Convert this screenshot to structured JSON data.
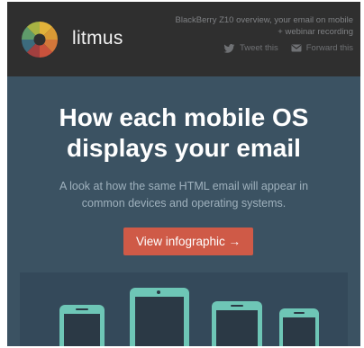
{
  "header": {
    "brand": "litmus",
    "promo_text": "BlackBerry Z10 overview, your email on mobile + webinar recording",
    "actions": [
      {
        "label": "Tweet this",
        "icon": "twitter-bird-icon"
      },
      {
        "label": "Forward this",
        "icon": "envelope-icon"
      }
    ]
  },
  "hero": {
    "title_line1": "How each mobile OS",
    "title_line2": "displays your email",
    "subtitle_line1": "A look at how the same HTML email will appear in",
    "subtitle_line2": "common devices and operating systems.",
    "cta_label": "View infographic →"
  },
  "devices": [
    "phone-device",
    "tablet-device",
    "phone-device",
    "phone-device"
  ],
  "colors": {
    "header_bg": "#2f2f2f",
    "body_bg": "#3b5262",
    "cta_bg": "#cf5a47",
    "device_accent": "#6ec6b6"
  }
}
